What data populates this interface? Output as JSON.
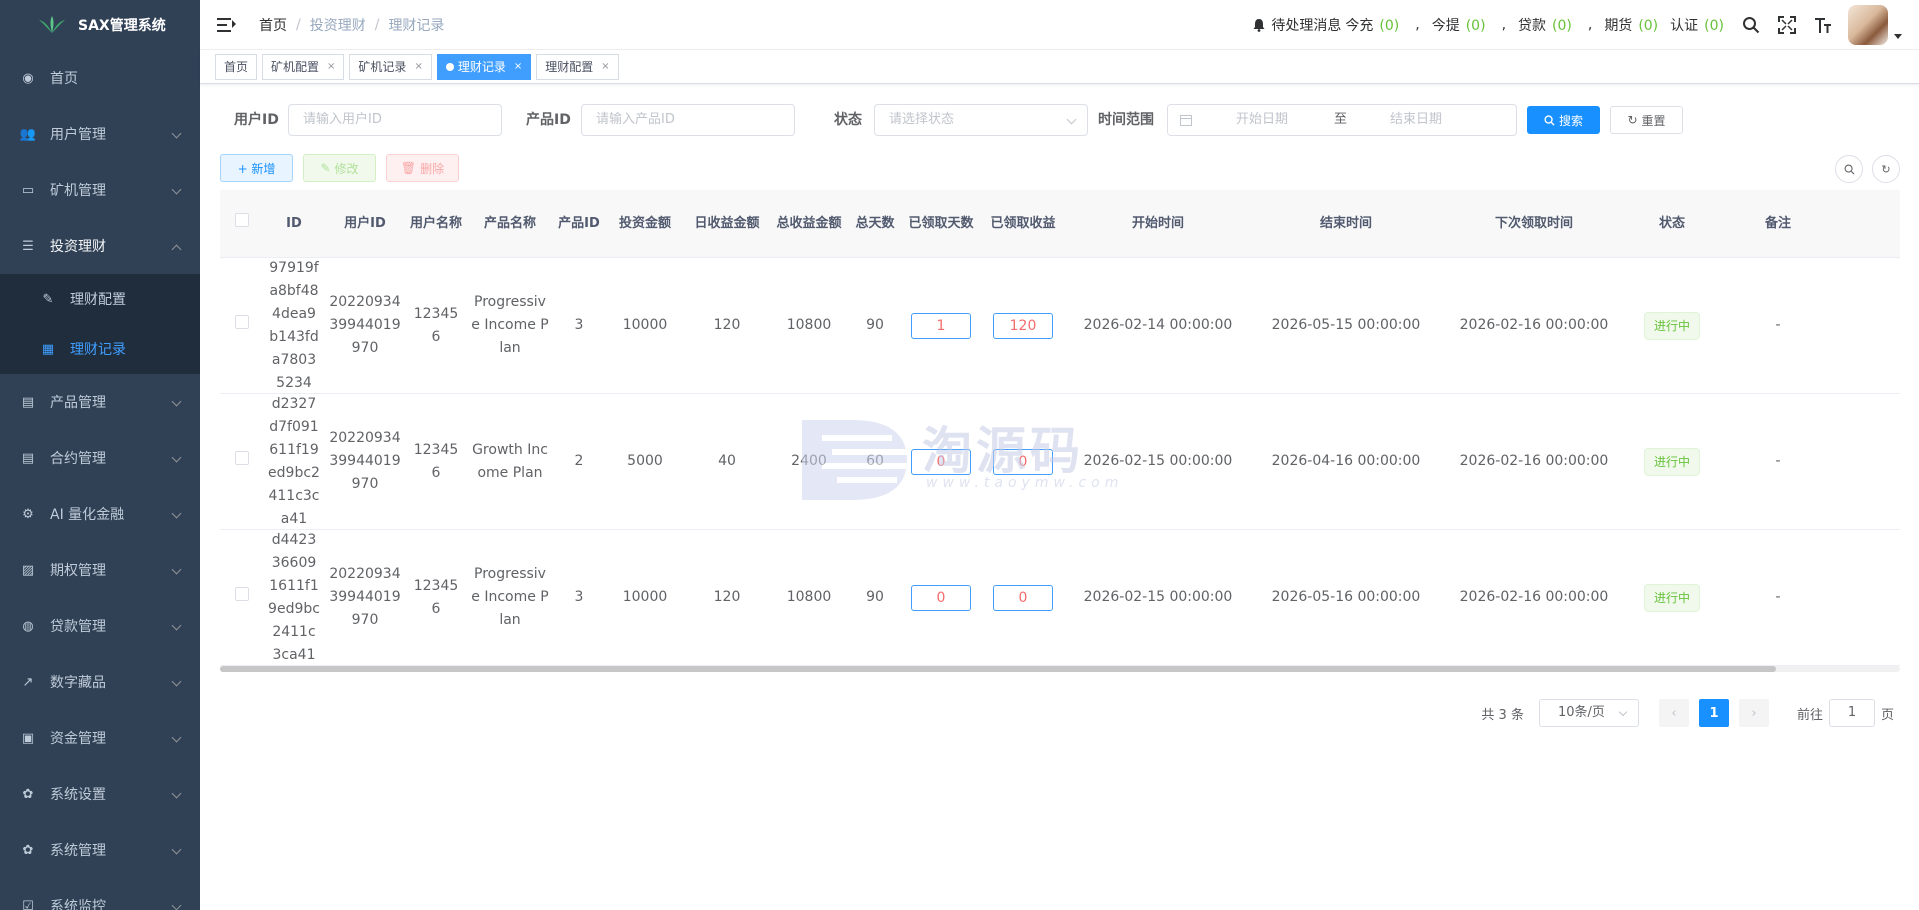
{
  "app": {
    "title": "SAX管理系统"
  },
  "sidebar": {
    "items": [
      {
        "label": "首页",
        "icon": "dashboard-icon"
      },
      {
        "label": "用户管理",
        "icon": "users-icon"
      },
      {
        "label": "矿机管理",
        "icon": "monitor-icon"
      },
      {
        "label": "投资理财",
        "icon": "database-icon",
        "open": true
      },
      {
        "label": "理财配置",
        "icon": "edit-icon",
        "sub": true
      },
      {
        "label": "理财记录",
        "icon": "table-icon",
        "sub": true,
        "active": true
      },
      {
        "label": "产品管理",
        "icon": "document-icon"
      },
      {
        "label": "合约管理",
        "icon": "document-icon"
      },
      {
        "label": "AI 量化金融",
        "icon": "gear-small-icon"
      },
      {
        "label": "期权管理",
        "icon": "chart-icon"
      },
      {
        "label": "贷款管理",
        "icon": "money-icon"
      },
      {
        "label": "数字藏品",
        "icon": "trend-icon"
      },
      {
        "label": "资金管理",
        "icon": "bank-icon"
      },
      {
        "label": "系统设置",
        "icon": "gear-icon"
      },
      {
        "label": "系统管理",
        "icon": "gear-icon"
      },
      {
        "label": "系统监控",
        "icon": "monitor-check-icon"
      }
    ]
  },
  "header": {
    "breadcrumb": [
      "首页",
      "投资理财",
      "理财记录"
    ],
    "notice_label": "待处理消息",
    "notices": [
      {
        "label": "今充",
        "count": "(0)"
      },
      {
        "label": "今提",
        "count": "(0)"
      },
      {
        "label": "贷款",
        "count": "(0)"
      },
      {
        "label": "期货",
        "count": "(0)"
      },
      {
        "label": "认证",
        "count": "(0)"
      }
    ],
    "separator": ","
  },
  "tags": [
    {
      "label": "首页"
    },
    {
      "label": "矿机配置"
    },
    {
      "label": "矿机记录"
    },
    {
      "label": "理财记录",
      "active": true
    },
    {
      "label": "理财配置"
    }
  ],
  "search": {
    "user_id_label": "用户ID",
    "user_id_placeholder": "请输入用户ID",
    "product_id_label": "产品ID",
    "product_id_placeholder": "请输入产品ID",
    "status_label": "状态",
    "status_placeholder": "请选择状态",
    "range_label": "时间范围",
    "range_start": "开始日期",
    "range_sep": "至",
    "range_end": "结束日期",
    "search_btn": "搜索",
    "reset_btn": "重置"
  },
  "toolbar": {
    "add": "+ 新增",
    "edit": "修改",
    "delete": "删除"
  },
  "table": {
    "columns": [
      {
        "label": "ID"
      },
      {
        "label": "用户ID"
      },
      {
        "label": "用户名称"
      },
      {
        "label": "产品名称"
      },
      {
        "label": "产品ID"
      },
      {
        "label": "投资金额"
      },
      {
        "label": "日收益金额"
      },
      {
        "label": "总收益金额"
      },
      {
        "label": "总天数"
      },
      {
        "label": "已领取天数"
      },
      {
        "label": "已领取收益"
      },
      {
        "label": "开始时间"
      },
      {
        "label": "结束时间"
      },
      {
        "label": "下次领取时间"
      },
      {
        "label": "状态"
      },
      {
        "label": "备注"
      }
    ],
    "rows": [
      {
        "id": "97919fa8bf484dea9b143fda78035234",
        "user_id": "2022093439944019970",
        "user_name": "123456",
        "product_name": "Progressive Income Plan",
        "product_id": "3",
        "amount": "10000",
        "daily": "120",
        "total": "10800",
        "days": "90",
        "claimed_days": "1",
        "claimed_income": "120",
        "start": "2026-02-14 00:00:00",
        "end": "2026-05-15 00:00:00",
        "next": "2026-02-16 00:00:00",
        "status": "进行中",
        "remark": "-"
      },
      {
        "id": "d2327d7f091611f19ed9bc2411c3ca41",
        "user_id": "2022093439944019970",
        "user_name": "123456",
        "product_name": "Growth Income Plan",
        "product_id": "2",
        "amount": "5000",
        "daily": "40",
        "total": "2400",
        "days": "60",
        "claimed_days": "0",
        "claimed_income": "0",
        "start": "2026-02-15 00:00:00",
        "end": "2026-04-16 00:00:00",
        "next": "2026-02-16 00:00:00",
        "status": "进行中",
        "remark": "-"
      },
      {
        "id": "d4423366091611f19ed9bc2411c3ca41",
        "user_id": "2022093439944019970",
        "user_name": "123456",
        "product_name": "Progressive Income Plan",
        "product_id": "3",
        "amount": "10000",
        "daily": "120",
        "total": "10800",
        "days": "90",
        "claimed_days": "0",
        "claimed_income": "0",
        "start": "2026-02-15 00:00:00",
        "end": "2026-05-16 00:00:00",
        "next": "2026-02-16 00:00:00",
        "status": "进行中",
        "remark": "-"
      }
    ]
  },
  "pagination": {
    "total": "共 3 条",
    "page_size": "10条/页",
    "current": "1",
    "goto_label": "前往",
    "goto_value": "1",
    "goto_suffix": "页"
  },
  "watermark": {
    "text": "淘源码",
    "sub": "www.taoymw.com"
  }
}
